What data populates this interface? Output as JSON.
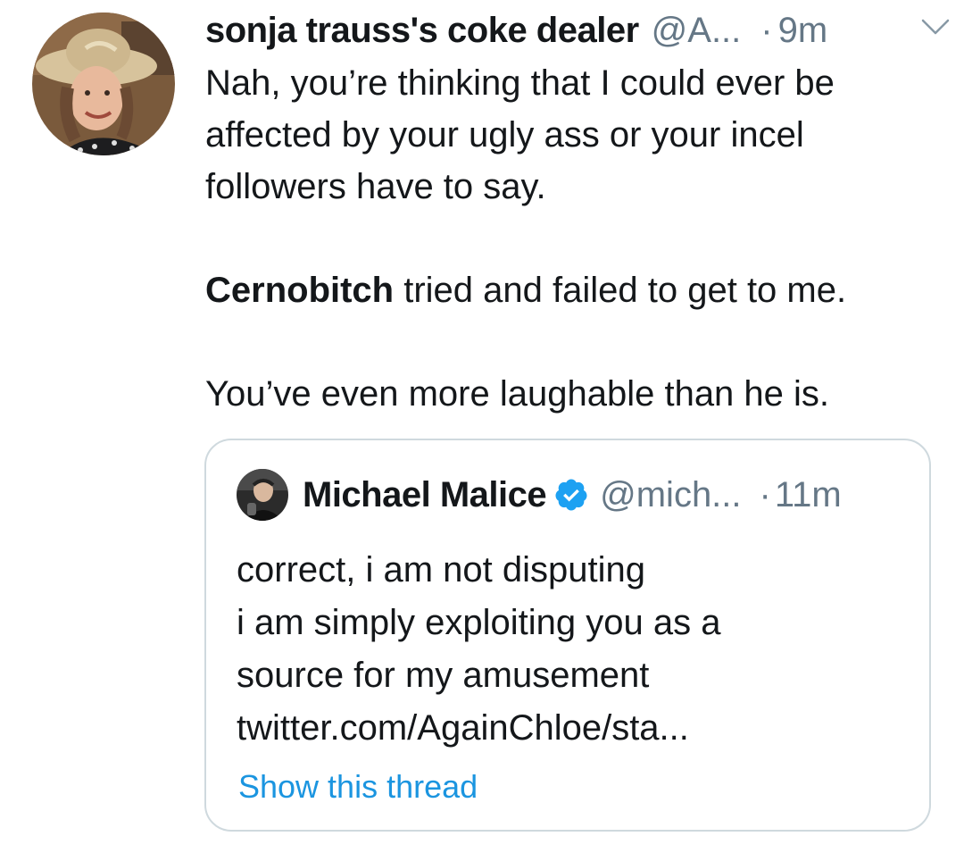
{
  "tweet": {
    "author": {
      "display_name": "sonja trauss's coke dealer",
      "handle": "@A...",
      "avatar_icon": "profile-photo-woman-in-sun-hat"
    },
    "separator": "·",
    "time": "9m",
    "menu_icon": "chevron-down-icon",
    "body": {
      "line1": "Nah, you’re thinking that I could ever be affected by your ugly ass or your incel followers have to say.",
      "bold_word": "Cernobitch",
      "line2_rest": " tried and failed to get to me.",
      "line3": "You’ve even more laughable than he is."
    },
    "quoted_tweet": {
      "display_name": "Michael Malice",
      "verified_icon": "verified-badge-icon",
      "handle": "@mich...",
      "separator": "·",
      "time": "11m",
      "avatar_icon": "profile-photo-man-with-microphone",
      "lines": [
        "correct, i am not disputing",
        "i am simply exploiting you as a",
        "source for my amusement",
        "twitter.com/AgainChloe/sta..."
      ],
      "thread_link": "Show this thread"
    },
    "colors": {
      "text": "#14171a",
      "secondary": "#657786",
      "link": "#1b95e0",
      "verified": "#1da1f2",
      "border": "#cfd9de"
    }
  }
}
